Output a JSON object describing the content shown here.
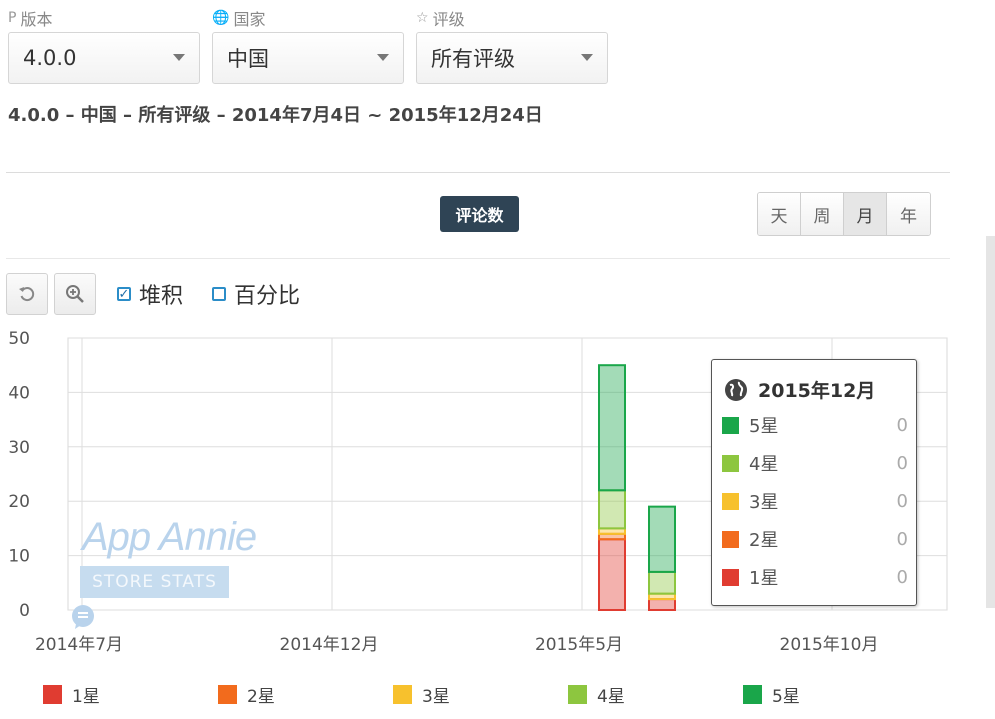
{
  "filters": [
    {
      "icon": "version-icon",
      "glyph": "P",
      "label": "版本",
      "value": "4.0.0"
    },
    {
      "icon": "globe-icon",
      "glyph": "🌐",
      "label": "国家",
      "value": "中国"
    },
    {
      "icon": "star-icon",
      "glyph": "☆",
      "label": "评级",
      "value": "所有评级"
    }
  ],
  "summary": "4.0.0 – 中国 – 所有评级 – 2014年7月4日 ~ 2015年12月24日",
  "metric_badge": "评论数",
  "periods": [
    "天",
    "周",
    "月",
    "年"
  ],
  "active_period": "月",
  "toolbar": {
    "stacked_label": "堆积",
    "stacked_checked": true,
    "percent_label": "百分比",
    "percent_checked": false
  },
  "watermark": {
    "brand": "App Annie",
    "sub": "STORE STATS"
  },
  "tooltip": {
    "title": "2015年12月",
    "rows": [
      {
        "label": "5星",
        "value": "0",
        "color": "#1aa64a"
      },
      {
        "label": "4星",
        "value": "0",
        "color": "#8dc63f"
      },
      {
        "label": "3星",
        "value": "0",
        "color": "#f7c12d"
      },
      {
        "label": "2星",
        "value": "0",
        "color": "#f26b1d"
      },
      {
        "label": "1星",
        "value": "0",
        "color": "#e03c31"
      }
    ]
  },
  "legend": [
    {
      "label": "1星",
      "color": "#e03c31"
    },
    {
      "label": "2星",
      "color": "#f26b1d"
    },
    {
      "label": "3星",
      "color": "#f7c12d"
    },
    {
      "label": "4星",
      "color": "#8dc63f"
    },
    {
      "label": "5星",
      "color": "#1aa64a"
    }
  ],
  "chart_data": {
    "type": "bar",
    "stacked": true,
    "ylim": [
      0,
      50
    ],
    "yticks": [
      0,
      10,
      20,
      30,
      40,
      50
    ],
    "xticks": [
      "2014年7月",
      "2014年12月",
      "2015年5月",
      "2015年10月"
    ],
    "categories": [
      "2015年6月",
      "2015年7月"
    ],
    "series": [
      {
        "name": "1星",
        "color": "#e03c31",
        "values": [
          13,
          2
        ]
      },
      {
        "name": "2星",
        "color": "#f26b1d",
        "values": [
          1,
          0
        ]
      },
      {
        "name": "3星",
        "color": "#f7c12d",
        "values": [
          1,
          1
        ]
      },
      {
        "name": "4星",
        "color": "#8dc63f",
        "values": [
          7,
          4
        ]
      },
      {
        "name": "5星",
        "color": "#1aa64a",
        "values": [
          23,
          12
        ]
      }
    ]
  }
}
